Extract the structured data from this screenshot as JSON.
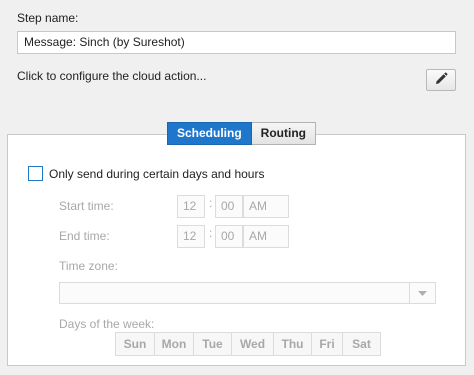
{
  "step": {
    "label": "Step name:",
    "value": "Message: Sinch (by Sureshot)"
  },
  "cloud_action": {
    "text": "Click to configure the cloud action...",
    "edit_icon": "pencil-icon"
  },
  "tabs": [
    {
      "label": "Scheduling",
      "active": true
    },
    {
      "label": "Routing",
      "active": false
    }
  ],
  "schedule": {
    "checkbox_label": "Only send during certain days and hours",
    "checked": false,
    "start_time": {
      "label": "Start time:",
      "hour": "12",
      "minute": "00",
      "ampm": "AM"
    },
    "end_time": {
      "label": "End time:",
      "hour": "12",
      "minute": "00",
      "ampm": "AM"
    },
    "time_zone": {
      "label": "Time zone:",
      "value": ""
    },
    "days_label": "Days of the week:",
    "days": [
      "Sun",
      "Mon",
      "Tue",
      "Wed",
      "Thu",
      "Fri",
      "Sat"
    ]
  },
  "colors": {
    "accent": "#1f77cc",
    "disabled_text": "#a8a8a8"
  }
}
